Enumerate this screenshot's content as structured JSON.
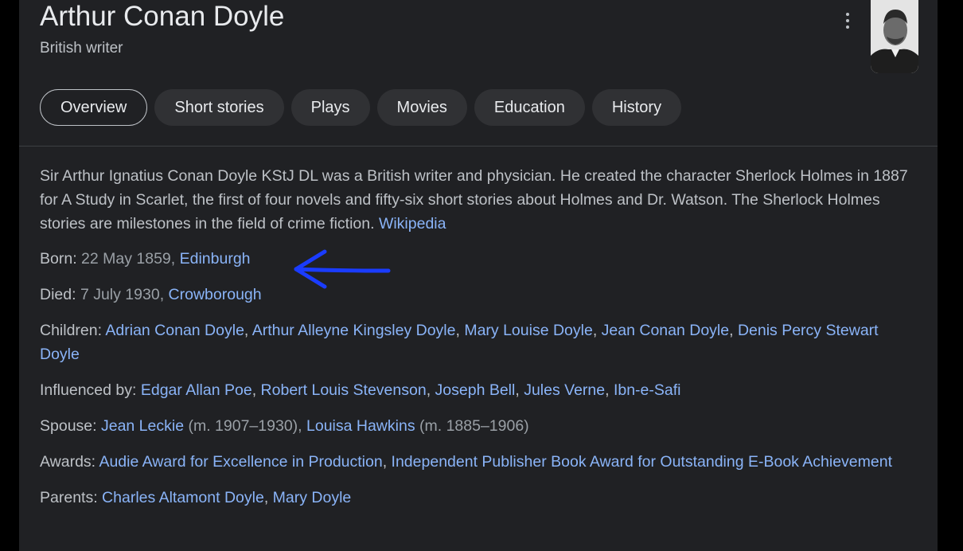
{
  "header": {
    "title": "Arthur Conan Doyle",
    "subtitle": "British writer"
  },
  "tabs": [
    {
      "label": "Overview",
      "active": true
    },
    {
      "label": "Short stories"
    },
    {
      "label": "Plays"
    },
    {
      "label": "Movies"
    },
    {
      "label": "Education"
    },
    {
      "label": "History"
    }
  ],
  "description": {
    "text": "Sir Arthur Ignatius Conan Doyle KStJ DL was a British writer and physician. He created the character Sherlock Holmes in 1887 for A Study in Scarlet, the first of four novels and fifty-six short stories about Holmes and Dr. Watson. The Sherlock Holmes stories are milestones in the field of crime fiction.",
    "source_link": "Wikipedia"
  },
  "facts": {
    "born": {
      "label": "Born:",
      "date": "22 May 1859,",
      "place": "Edinburgh"
    },
    "died": {
      "label": "Died:",
      "date": "7 July 1930,",
      "place": "Crowborough"
    },
    "children": {
      "label": "Children:",
      "items": [
        "Adrian Conan Doyle",
        "Arthur Alleyne Kingsley Doyle",
        "Mary Louise Doyle",
        "Jean Conan Doyle",
        "Denis Percy Stewart Doyle"
      ]
    },
    "influenced_by": {
      "label": "Influenced by:",
      "items": [
        "Edgar Allan Poe",
        "Robert Louis Stevenson",
        "Joseph Bell",
        "Jules Verne",
        "Ibn-e-Safi"
      ]
    },
    "spouse": {
      "label": "Spouse:",
      "items": [
        {
          "name": "Jean Leckie",
          "years": "(m. 1907–1930),"
        },
        {
          "name": "Louisa Hawkins",
          "years": "(m. 1885–1906)"
        }
      ]
    },
    "awards": {
      "label": "Awards:",
      "items": [
        "Audie Award for Excellence in Production",
        "Independent Publisher Book Award for Outstanding E-Book Achievement"
      ]
    },
    "parents": {
      "label": "Parents:",
      "items": [
        "Charles Altamont Doyle",
        "Mary Doyle"
      ]
    }
  },
  "colors": {
    "background": "#202124",
    "link": "#8ab4f8",
    "annotation_arrow": "#1a3cff"
  },
  "icons": {
    "more": "more-vert-icon",
    "portrait": "portrait-image"
  }
}
